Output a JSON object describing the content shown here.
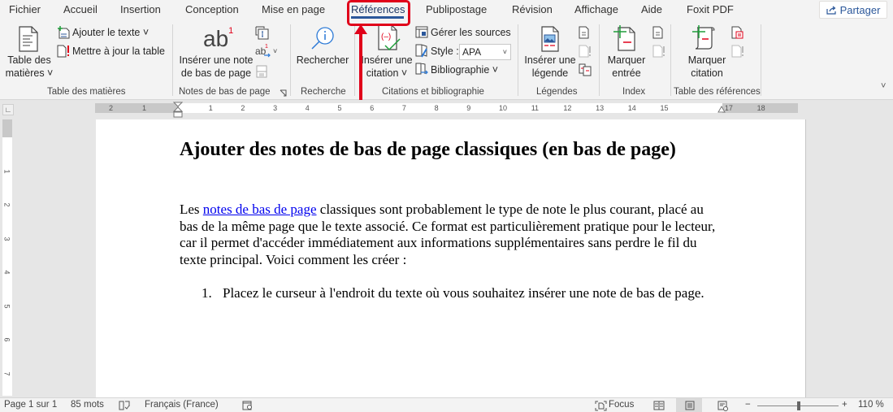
{
  "tabs": [
    {
      "label": "Fichier"
    },
    {
      "label": "Accueil"
    },
    {
      "label": "Insertion"
    },
    {
      "label": "Conception"
    },
    {
      "label": "Mise en page"
    },
    {
      "label": "Références",
      "active": true
    },
    {
      "label": "Publipostage"
    },
    {
      "label": "Révision"
    },
    {
      "label": "Affichage"
    },
    {
      "label": "Aide"
    },
    {
      "label": "Foxit PDF"
    }
  ],
  "share_label": "Partager",
  "ribbon": {
    "toc": {
      "group_label": "Table des matières",
      "table_btn": [
        "Table des",
        "matières ˅"
      ],
      "add_text": "Ajouter le texte ˅",
      "update_table": "Mettre à jour la table"
    },
    "footnotes": {
      "group_label": "Notes de bas de page",
      "insert_btn": [
        "Insérer une note",
        "de bas de page"
      ],
      "ab_glyph": "ab",
      "sup": "1"
    },
    "research": {
      "group_label": "Recherche",
      "search_btn": "Rechercher"
    },
    "citations": {
      "group_label": "Citations et bibliographie",
      "insert_btn": [
        "Insérer une",
        "citation ˅"
      ],
      "manage_sources": "Gérer les sources",
      "style_label": "Style :",
      "style_value": "APA",
      "bibliography": "Bibliographie ˅"
    },
    "captions": {
      "group_label": "Légendes",
      "insert_btn": [
        "Insérer une",
        "légende"
      ]
    },
    "index": {
      "group_label": "Index",
      "mark_btn": [
        "Marquer",
        "entrée"
      ]
    },
    "toa": {
      "group_label": "Table des références",
      "mark_btn": [
        "Marquer",
        "citation"
      ]
    }
  },
  "ruler": {
    "left_ticks": [
      "2",
      "1"
    ],
    "ticks": [
      "1",
      "2",
      "3",
      "4",
      "5",
      "6",
      "7",
      "8",
      "9",
      "10",
      "11",
      "12",
      "13",
      "14",
      "15",
      "17",
      "18"
    ],
    "vticks": [
      "1",
      "2",
      "3",
      "4",
      "5",
      "6",
      "7"
    ]
  },
  "document": {
    "title": "Ajouter des notes de bas de page classiques (en bas de page)",
    "para_link": "notes de bas de page",
    "para_before": "Les ",
    "para_after": " classiques sont probablement le type de note le plus courant, placé au bas de la même page que le texte associé. Ce format est particulièrement pratique pour le lecteur, car il permet d'accéder immédiatement aux informations supplémentaires sans perdre le fil du texte principal. Voici comment les créer :",
    "list": [
      {
        "num": "1.",
        "text": "Placez le curseur à l'endroit du texte où vous souhaitez insérer une note de bas de page."
      }
    ]
  },
  "status": {
    "page": "Page 1 sur 1",
    "words": "85 mots",
    "language": "Français (France)",
    "focus": "Focus",
    "zoom_minus": "−",
    "zoom_plus": "+",
    "zoom": "110 %",
    "zoom_percent": 110
  },
  "colors": {
    "accent": "#2b579a",
    "annotation": "#e0001a",
    "link": "#0000ee"
  }
}
